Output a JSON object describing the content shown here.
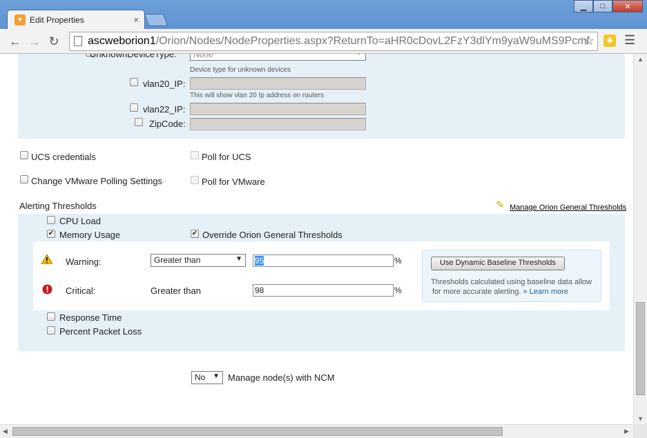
{
  "browser": {
    "tab_title": "Edit Properties",
    "url_host": "ascweborion1",
    "url_path": "/Orion/Nodes/NodeProperties.aspx?ReturnTo=aHR0cDovL2FzY3dlYm9yaW9uMS9Pcml",
    "tab_close": "×",
    "win_minimize": "▁",
    "win_maximize": "□",
    "win_close": "✕"
  },
  "custom_properties": {
    "unknown_device_label": "UnknownDeviceType:",
    "unknown_device_value": "None",
    "unknown_device_hint": "Device type for unknown devices",
    "vlan20_label": "vlan20_IP:",
    "vlan20_hint": "This will show vlan 20 Ip address on routers",
    "vlan22_label": "vlan22_IP:",
    "zipcode_label": "ZipCode:"
  },
  "ucs": {
    "credentials_label": "UCS credentials",
    "poll_label": "Poll for UCS"
  },
  "vmware": {
    "settings_label": "Change VMware Polling Settings",
    "poll_label": "Poll for VMware"
  },
  "alerting": {
    "heading": "Alerting Thresholds",
    "manage_link": "Manage Orion General Thresholds",
    "cpu_load": "CPU Load",
    "memory_usage": "Memory Usage",
    "override_label": "Override Orion General Thresholds",
    "warning_label": "Warning:",
    "warning_operator": "Greater than",
    "warning_value": "95",
    "critical_label": "Critical:",
    "critical_operator": "Greater than",
    "critical_value": "98",
    "percent": "%",
    "baseline_button": "Use Dynamic Baseline Thresholds",
    "baseline_desc_1": "Thresholds calculated using baseline data allow",
    "baseline_desc_2": "for more accurate alerting.",
    "learn_more": "» Learn more",
    "response_time": "Response Time",
    "packet_loss": "Percent Packet Loss"
  },
  "ncm": {
    "select_value": "No",
    "label": "Manage node(s) with NCM"
  }
}
